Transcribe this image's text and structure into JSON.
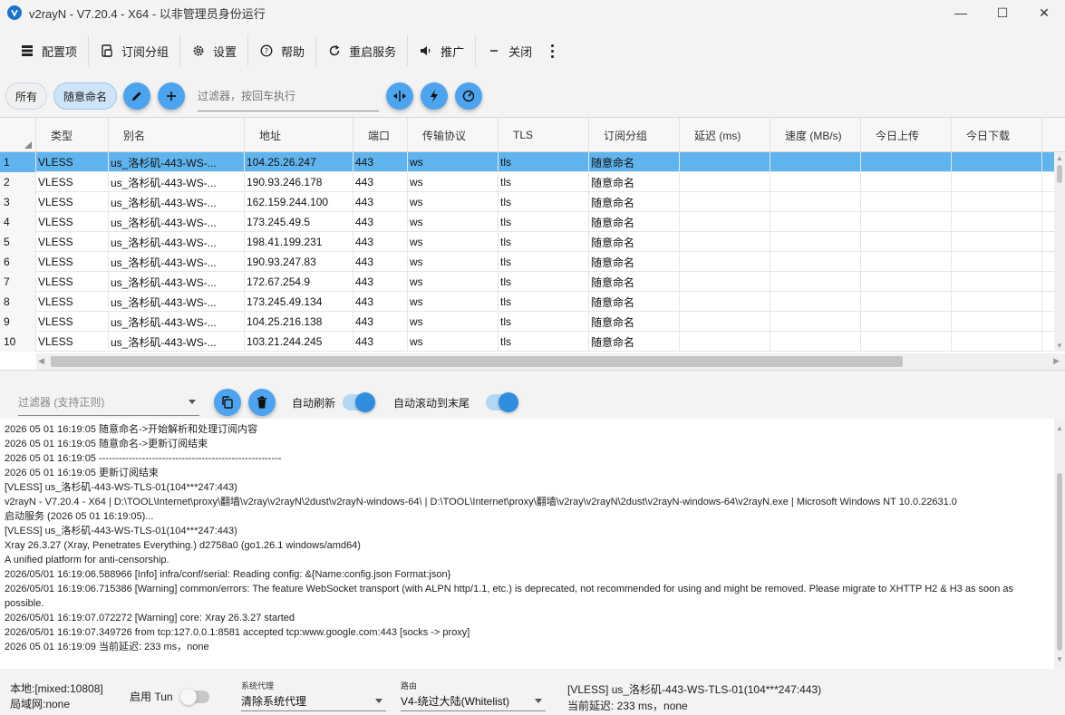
{
  "window": {
    "title": "v2rayN - V7.20.4 - X64 - 以非管理员身份运行",
    "minimize": "—",
    "maximize": "☐",
    "close": "✕"
  },
  "toolbar": {
    "profiles": "配置项",
    "subscription": "订阅分组",
    "settings": "设置",
    "help": "帮助",
    "restart": "重启服务",
    "promotion": "推广",
    "close": "关闭"
  },
  "filter_bar": {
    "tab_all": "所有",
    "tab_group": "随意命名",
    "placeholder": "过滤器，按回车执行"
  },
  "grid": {
    "columns": [
      "类型",
      "别名",
      "地址",
      "端口",
      "传输协议",
      "TLS",
      "订阅分组",
      "延迟 (ms)",
      "速度 (MB/s)",
      "今日上传",
      "今日下载"
    ],
    "rows": [
      {
        "n": "1",
        "type": "VLESS",
        "alias": "us_洛杉矶-443-WS-...",
        "addr": "104.25.26.247",
        "port": "443",
        "net": "ws",
        "tls": "tls",
        "group": "随意命名"
      },
      {
        "n": "2",
        "type": "VLESS",
        "alias": "us_洛杉矶-443-WS-...",
        "addr": "190.93.246.178",
        "port": "443",
        "net": "ws",
        "tls": "tls",
        "group": "随意命名"
      },
      {
        "n": "3",
        "type": "VLESS",
        "alias": "us_洛杉矶-443-WS-...",
        "addr": "162.159.244.100",
        "port": "443",
        "net": "ws",
        "tls": "tls",
        "group": "随意命名"
      },
      {
        "n": "4",
        "type": "VLESS",
        "alias": "us_洛杉矶-443-WS-...",
        "addr": "173.245.49.5",
        "port": "443",
        "net": "ws",
        "tls": "tls",
        "group": "随意命名"
      },
      {
        "n": "5",
        "type": "VLESS",
        "alias": "us_洛杉矶-443-WS-...",
        "addr": "198.41.199.231",
        "port": "443",
        "net": "ws",
        "tls": "tls",
        "group": "随意命名"
      },
      {
        "n": "6",
        "type": "VLESS",
        "alias": "us_洛杉矶-443-WS-...",
        "addr": "190.93.247.83",
        "port": "443",
        "net": "ws",
        "tls": "tls",
        "group": "随意命名"
      },
      {
        "n": "7",
        "type": "VLESS",
        "alias": "us_洛杉矶-443-WS-...",
        "addr": "172.67.254.9",
        "port": "443",
        "net": "ws",
        "tls": "tls",
        "group": "随意命名"
      },
      {
        "n": "8",
        "type": "VLESS",
        "alias": "us_洛杉矶-443-WS-...",
        "addr": "173.245.49.134",
        "port": "443",
        "net": "ws",
        "tls": "tls",
        "group": "随意命名"
      },
      {
        "n": "9",
        "type": "VLESS",
        "alias": "us_洛杉矶-443-WS-...",
        "addr": "104.25.216.138",
        "port": "443",
        "net": "ws",
        "tls": "tls",
        "group": "随意命名"
      },
      {
        "n": "10",
        "type": "VLESS",
        "alias": "us_洛杉矶-443-WS-...",
        "addr": "103.21.244.245",
        "port": "443",
        "net": "ws",
        "tls": "tls",
        "group": "随意命名"
      }
    ]
  },
  "log_controls": {
    "filter_placeholder": "过滤器 (支持正则)",
    "auto_refresh": "自动刷新",
    "auto_scroll": "自动滚动到末尾"
  },
  "log_lines": [
    "2026 05 01 16:19:05 随意命名->开始解析和处理订阅内容",
    "2026 05 01 16:19:05 随意命名->更新订阅结束",
    "2026 05 01 16:19:05 -------------------------------------------------------",
    "2026 05 01 16:19:05 更新订阅结束",
    "[VLESS] us_洛杉矶-443-WS-TLS-01(104***247:443)",
    "v2rayN - V7.20.4 - X64 | D:\\TOOL\\Internet\\proxy\\翻墙\\v2ray\\v2rayN\\2dust\\v2rayN-windows-64\\ | D:\\TOOL\\Internet\\proxy\\翻墙\\v2ray\\v2rayN\\2dust\\v2rayN-windows-64\\v2rayN.exe | Microsoft Windows NT 10.0.22631.0",
    "启动服务 (2026 05 01 16:19:05)...",
    "[VLESS] us_洛杉矶-443-WS-TLS-01(104***247:443)",
    "Xray 26.3.27 (Xray, Penetrates Everything.) d2758a0 (go1.26.1 windows/amd64)",
    "A unified platform for anti-censorship.",
    "2026/05/01 16:19:06.588966 [Info] infra/conf/serial: Reading config: &{Name:config.json Format:json}",
    "2026/05/01 16:19:06.715386 [Warning] common/errors: The feature WebSocket transport (with ALPN http/1.1, etc.) is deprecated, not recommended for using and might be removed. Please migrate to XHTTP H2 & H3 as soon as possible.",
    "2026/05/01 16:19:07.072272 [Warning] core: Xray 26.3.27 started",
    "2026/05/01 16:19:07.349726 from tcp:127.0.0.1:8581 accepted tcp:www.google.com:443 [socks -> proxy]",
    "2026 05 01 16:19:09 当前延迟: 233 ms，none"
  ],
  "status": {
    "local": "本地:[mixed:10808]",
    "lan": "局域网:none",
    "tun_label": "启用 Tun",
    "sysproxy_caption": "系统代理",
    "sysproxy_value": "清除系统代理",
    "routing_caption": "路由",
    "routing_value": "V4-绕过大陆(Whitelist)",
    "current_server": "[VLESS] us_洛杉矶-443-WS-TLS-01(104***247:443)",
    "current_delay": "当前延迟: 233 ms，none"
  },
  "colors": {
    "accent": "#4ea3ee",
    "selected_row": "#5fb4ee"
  }
}
